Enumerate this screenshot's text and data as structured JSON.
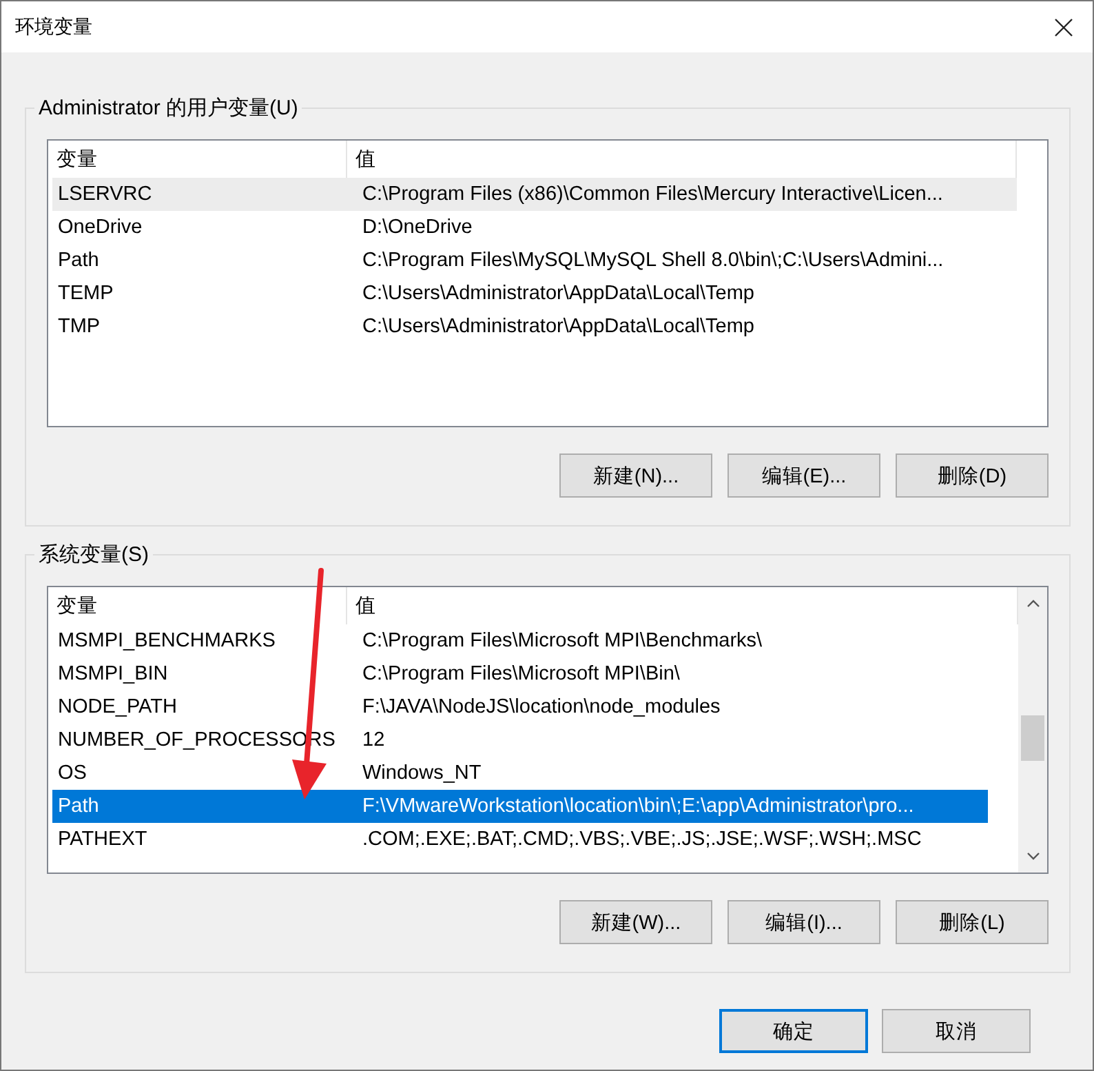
{
  "window": {
    "title": "环境变量"
  },
  "groups": [
    {
      "label": "Administrator 的用户变量(U)",
      "focused": false,
      "scrollbar": false,
      "columns": [
        "变量",
        "值"
      ],
      "rows": [
        {
          "name": "LSERVRC",
          "value": "C:\\Program Files (x86)\\Common Files\\Mercury Interactive\\Licen...",
          "selected": true
        },
        {
          "name": "OneDrive",
          "value": "D:\\OneDrive",
          "selected": false
        },
        {
          "name": "Path",
          "value": "C:\\Program Files\\MySQL\\MySQL Shell 8.0\\bin\\;C:\\Users\\Admini...",
          "selected": false
        },
        {
          "name": "TEMP",
          "value": "C:\\Users\\Administrator\\AppData\\Local\\Temp",
          "selected": false
        },
        {
          "name": "TMP",
          "value": "C:\\Users\\Administrator\\AppData\\Local\\Temp",
          "selected": false
        }
      ],
      "buttons": [
        "新建(N)...",
        "编辑(E)...",
        "删除(D)"
      ]
    },
    {
      "label": "系统变量(S)",
      "focused": true,
      "scrollbar": true,
      "columns": [
        "变量",
        "值"
      ],
      "rows": [
        {
          "name": "MSMPI_BENCHMARKS",
          "value": "C:\\Program Files\\Microsoft MPI\\Benchmarks\\",
          "selected": false
        },
        {
          "name": "MSMPI_BIN",
          "value": "C:\\Program Files\\Microsoft MPI\\Bin\\",
          "selected": false
        },
        {
          "name": "NODE_PATH",
          "value": "F:\\JAVA\\NodeJS\\location\\node_modules",
          "selected": false
        },
        {
          "name": "NUMBER_OF_PROCESSORS",
          "value": "12",
          "selected": false
        },
        {
          "name": "OS",
          "value": "Windows_NT",
          "selected": false
        },
        {
          "name": "Path",
          "value": "F:\\VMwareWorkstation\\location\\bin\\;E:\\app\\Administrator\\pro...",
          "selected": true
        },
        {
          "name": "PATHEXT",
          "value": ".COM;.EXE;.BAT;.CMD;.VBS;.VBE;.JS;.JSE;.WSF;.WSH;.MSC",
          "selected": false
        }
      ],
      "buttons": [
        "新建(W)...",
        "编辑(I)...",
        "删除(L)"
      ]
    }
  ],
  "footer_buttons": [
    {
      "label": "确定",
      "default": true
    },
    {
      "label": "取消",
      "default": false
    }
  ]
}
